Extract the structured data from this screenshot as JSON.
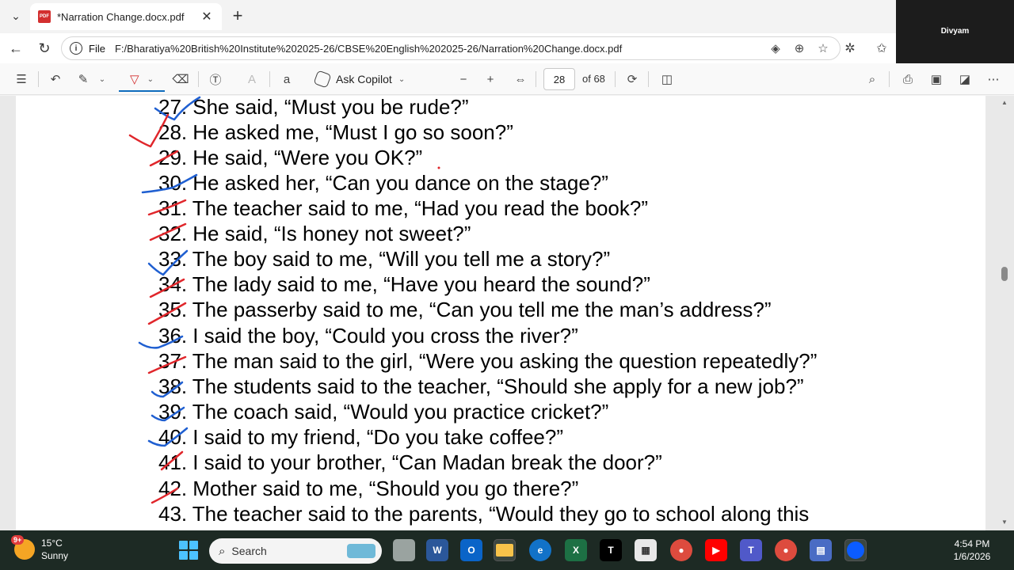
{
  "tab": {
    "title": "*Narration Change.docx.pdf",
    "icon_label": "PDF"
  },
  "zoom": {
    "participant_name": "Divyam"
  },
  "address": {
    "scheme_label": "File",
    "url": "F:/Bharatiya%20British%20Institute%202025-26/CBSE%20English%202025-26/Narration%20Change.docx.pdf"
  },
  "toolbar": {
    "ask_copilot": "Ask Copilot",
    "page_current": "28",
    "page_total": "of 68"
  },
  "document": {
    "lines": [
      {
        "num": "27.",
        "text": "She said, “Must you be rude?”"
      },
      {
        "num": "28.",
        "text": "He asked me, “Must I go so soon?”"
      },
      {
        "num": "29.",
        "text": "He said, “Were you OK?”"
      },
      {
        "num": "30.",
        "text": "He asked her, “Can you dance on the stage?”"
      },
      {
        "num": "31.",
        "text": "The teacher said to me, “Had you read the book?”"
      },
      {
        "num": "32.",
        "text": "He said, “Is honey not sweet?”"
      },
      {
        "num": "33.",
        "text": "The boy said to me, “Will you tell me a story?”"
      },
      {
        "num": "34.",
        "text": "The lady said to me, “Have you heard the sound?”"
      },
      {
        "num": "35.",
        "text": "The passerby said to me, “Can you tell me the man’s address?”"
      },
      {
        "num": "36.",
        "text": "I said the boy, “Could you cross the river?”"
      },
      {
        "num": "37.",
        "text": "The man said to the girl, “Were you asking the question repeatedly?”"
      },
      {
        "num": "38.",
        "text": "The students said to the teacher, “Should she apply for a new job?”"
      },
      {
        "num": "39.",
        "text": "The coach said, “Would you practice cricket?”"
      },
      {
        "num": "40.",
        "text": "I said to my friend, “Do you take coffee?”"
      },
      {
        "num": "41.",
        "text": "I said to your brother, “Can Madan break the door?”"
      },
      {
        "num": "42.",
        "text": "Mother said to me, “Should you go there?”"
      },
      {
        "num": "43.",
        "text": "The teacher said to the parents, “Would they go to school along this"
      }
    ]
  },
  "ink_colors": {
    "blue": "#1f5fd1",
    "red": "#e0262b"
  },
  "taskbar": {
    "weather_badge": "9+",
    "temperature": "15°C",
    "condition": "Sunny",
    "search_placeholder": "Search",
    "time": "4:54 PM",
    "date": "1/6/2026"
  }
}
